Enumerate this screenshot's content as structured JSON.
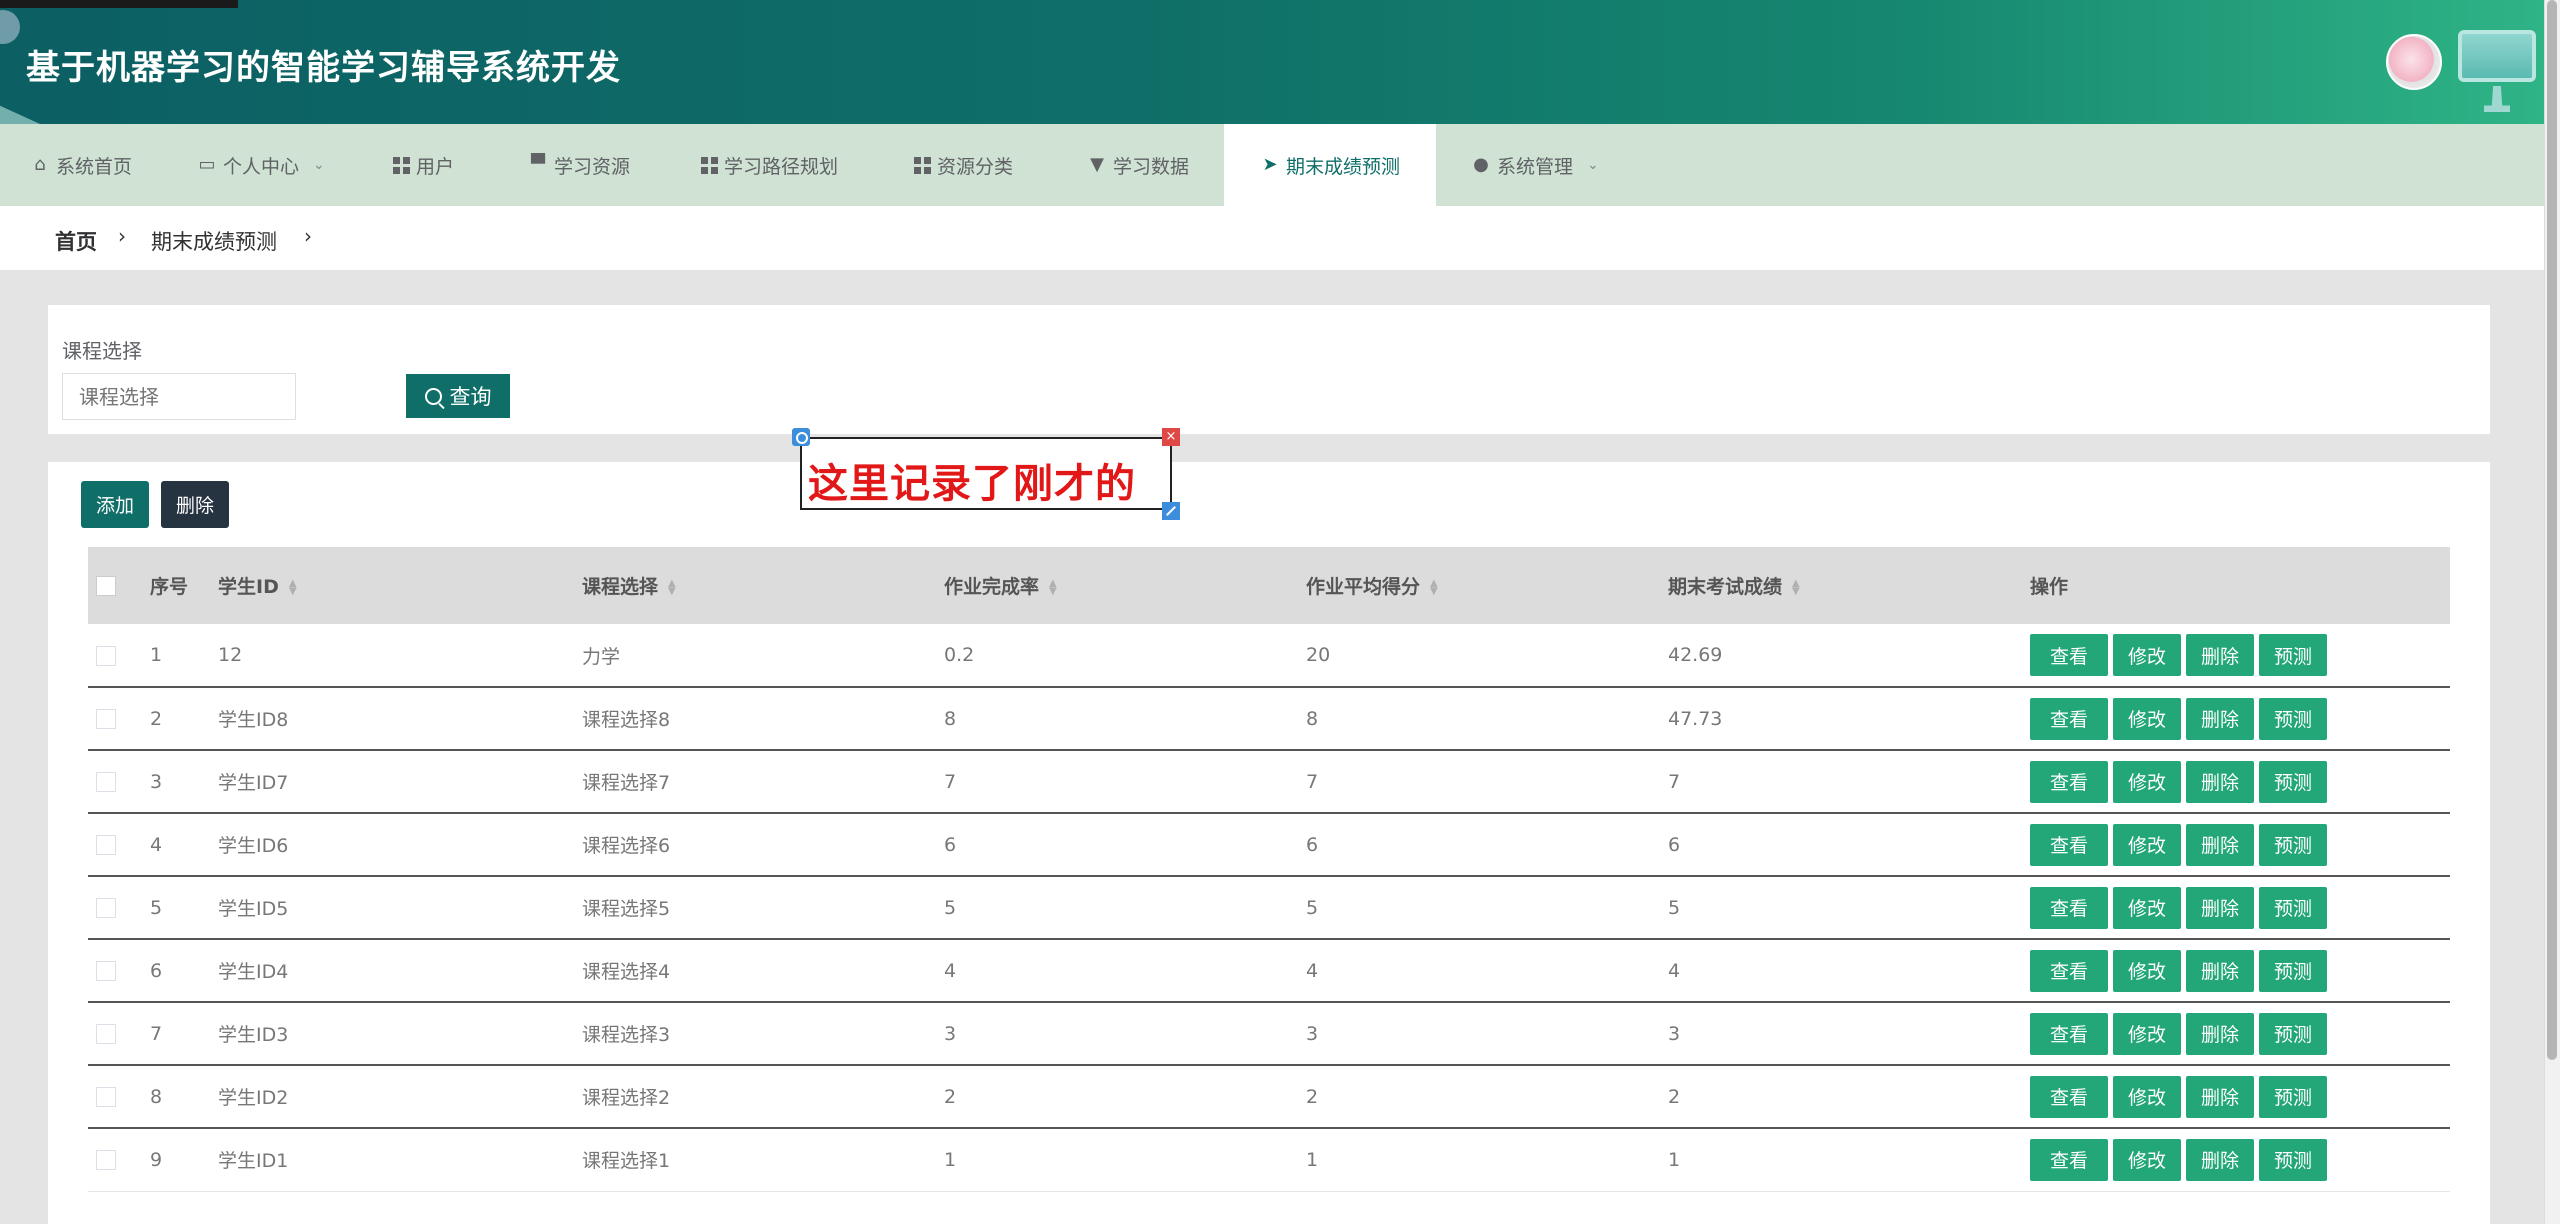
{
  "app": {
    "title": "基于机器学习的智能学习辅导系统开发"
  },
  "nav": {
    "items": [
      {
        "label": "系统首页",
        "icon": "home-icon",
        "active": false,
        "dropdown": false
      },
      {
        "label": "个人中心",
        "icon": "card-icon",
        "active": false,
        "dropdown": true
      },
      {
        "label": "用户",
        "icon": "grid-icon",
        "active": false,
        "dropdown": false
      },
      {
        "label": "学习资源",
        "icon": "inbox-icon",
        "active": false,
        "dropdown": false
      },
      {
        "label": "学习路径规划",
        "icon": "grid-icon",
        "active": false,
        "dropdown": false
      },
      {
        "label": "资源分类",
        "icon": "grid-icon",
        "active": false,
        "dropdown": false
      },
      {
        "label": "学习数据",
        "icon": "stamp-icon",
        "active": false,
        "dropdown": false
      },
      {
        "label": "期末成绩预测",
        "icon": "send-icon",
        "active": true,
        "dropdown": false
      },
      {
        "label": "系统管理",
        "icon": "user-icon",
        "active": false,
        "dropdown": true
      }
    ]
  },
  "breadcrumb": {
    "home": "首页",
    "current": "期末成绩预测",
    "separator": "›"
  },
  "search": {
    "label": "课程选择",
    "placeholder": "课程选择",
    "query_label": "查询"
  },
  "toolbar": {
    "add_label": "添加",
    "delete_label": "删除"
  },
  "overlay": {
    "text": "这里记录了刚才的",
    "close_glyph": "×"
  },
  "table": {
    "headers": {
      "index": "序号",
      "student_id": "学生ID",
      "course": "课程选择",
      "completion_rate": "作业完成率",
      "avg_score": "作业平均得分",
      "final_score": "期末考试成绩",
      "actions": "操作"
    },
    "rows": [
      {
        "index": "1",
        "student_id": "12",
        "course": "力学",
        "completion_rate": "0.2",
        "avg_score": "20",
        "final_score": "42.69"
      },
      {
        "index": "2",
        "student_id": "学生ID8",
        "course": "课程选择8",
        "completion_rate": "8",
        "avg_score": "8",
        "final_score": "47.73"
      },
      {
        "index": "3",
        "student_id": "学生ID7",
        "course": "课程选择7",
        "completion_rate": "7",
        "avg_score": "7",
        "final_score": "7"
      },
      {
        "index": "4",
        "student_id": "学生ID6",
        "course": "课程选择6",
        "completion_rate": "6",
        "avg_score": "6",
        "final_score": "6"
      },
      {
        "index": "5",
        "student_id": "学生ID5",
        "course": "课程选择5",
        "completion_rate": "5",
        "avg_score": "5",
        "final_score": "5"
      },
      {
        "index": "6",
        "student_id": "学生ID4",
        "course": "课程选择4",
        "completion_rate": "4",
        "avg_score": "4",
        "final_score": "4"
      },
      {
        "index": "7",
        "student_id": "学生ID3",
        "course": "课程选择3",
        "completion_rate": "3",
        "avg_score": "3",
        "final_score": "3"
      },
      {
        "index": "8",
        "student_id": "学生ID2",
        "course": "课程选择2",
        "completion_rate": "2",
        "avg_score": "2",
        "final_score": "2"
      },
      {
        "index": "9",
        "student_id": "学生ID1",
        "course": "课程选择1",
        "completion_rate": "1",
        "avg_score": "1",
        "final_score": "1"
      }
    ],
    "row_actions": {
      "view": "查看",
      "edit": "修改",
      "delete": "删除",
      "predict": "预测"
    }
  },
  "colors": {
    "primary": "#0f6f68",
    "action_button": "#23a778",
    "delete_button": "#263442",
    "nav_bg": "#cfe2d4",
    "overlay_text": "#e21818"
  }
}
